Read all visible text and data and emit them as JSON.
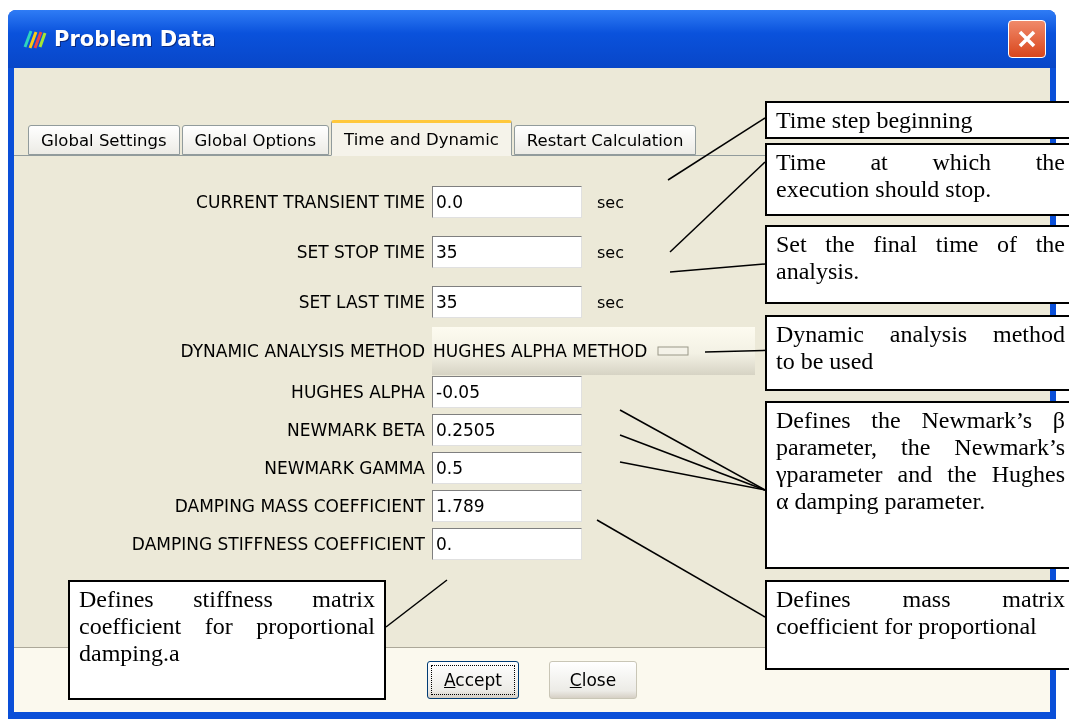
{
  "window": {
    "title": "Problem Data"
  },
  "tabs": [
    {
      "label": "Global Settings",
      "selected": false
    },
    {
      "label": "Global Options",
      "selected": false
    },
    {
      "label": "Time and Dynamic",
      "selected": true
    },
    {
      "label": "Restart Calculation",
      "selected": false
    }
  ],
  "fields": [
    {
      "kind": "text",
      "label": "CURRENT TRANSIENT TIME",
      "value": "0.0",
      "unit": "sec"
    },
    {
      "kind": "text",
      "label": "SET STOP TIME",
      "value": "35",
      "unit": "sec"
    },
    {
      "kind": "text",
      "label": "SET LAST TIME",
      "value": "35",
      "unit": "sec"
    },
    {
      "kind": "dropdown",
      "label": "DYNAMIC ANALYSIS METHOD",
      "value": "HUGHES ALPHA METHOD"
    },
    {
      "kind": "text",
      "label": "HUGHES ALPHA",
      "value": "-0.05"
    },
    {
      "kind": "text",
      "label": "NEWMARK BETA",
      "value": "0.2505"
    },
    {
      "kind": "text",
      "label": "NEWMARK GAMMA",
      "value": "0.5"
    },
    {
      "kind": "text",
      "label": "DAMPING MASS COEFFICIENT",
      "value": "1.789"
    },
    {
      "kind": "text",
      "label": "DAMPING STIFFNESS COEFFICIENT",
      "value": "0."
    }
  ],
  "buttons": [
    {
      "label": "Accept",
      "focused": true
    },
    {
      "label": "Close",
      "focused": false
    }
  ],
  "callouts": [
    {
      "lines": [
        "Time step beginning"
      ]
    },
    {
      "lines": [
        "Time at which the",
        "execution should stop."
      ]
    },
    {
      "lines": [
        "Set the final time of the",
        "analysis."
      ]
    },
    {
      "lines": [
        "Dynamic analysis method",
        "to be used"
      ]
    },
    {
      "lines": [
        "Defines the Newmark’s β",
        "parameter, the Newmark’s",
        "γparameter and the Hughes",
        "α damping parameter."
      ]
    },
    {
      "lines": [
        "Defines stiffness matrix",
        "coefficient for proportional",
        "damping.a"
      ]
    },
    {
      "lines": [
        "Defines mass matrix",
        "coefficient for proportional"
      ]
    }
  ]
}
